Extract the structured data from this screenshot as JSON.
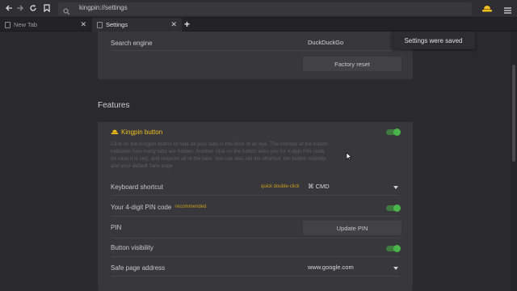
{
  "browser": {
    "url": "kingpin://settings",
    "tabs": [
      {
        "label": "New Tab",
        "active": false
      },
      {
        "label": "Settings",
        "active": true
      }
    ],
    "new_tab_glyph": "+",
    "close_glyph": "✕"
  },
  "general": {
    "search_engine_label": "Search engine",
    "search_engine_value": "DuckDuckGo",
    "factory_reset_label": "Factory reset"
  },
  "toast": {
    "text": "Settings were saved"
  },
  "features": {
    "section_title": "Features",
    "kingpin_button": {
      "title": "Kingpin button",
      "description": "Click on the Kingpin button to hide all your tabs in the blink of an eye. The number at the button indicates how many tabs are hidden. Another click on the button asks you for 4-digit PIN code (in case it is set), and reopens all of the tabs. You can also set the shortcut, the button visibility, and your default Safe page",
      "enabled": true
    },
    "keyboard_shortcut": {
      "label": "Keyboard shortcut",
      "hint": "quick double-click",
      "value": "⌘ CMD"
    },
    "pin_code": {
      "label": "Your 4-digit PIN code",
      "hint": "recommended",
      "enabled": true
    },
    "pin": {
      "label": "PIN",
      "button": "Update PIN"
    },
    "button_visibility": {
      "label": "Button visibility",
      "enabled": true
    },
    "safe_page": {
      "label": "Safe page address",
      "value": "www.google.com"
    }
  },
  "colors": {
    "accent_yellow": "#f0c020",
    "toggle_on": "#4ab64a",
    "background": "#2a2a2e",
    "card": "#38373b"
  },
  "icons": [
    "back-arrow-icon",
    "forward-arrow-icon",
    "reload-icon",
    "bookmark-icon",
    "search-icon",
    "kingpin-hat-icon",
    "menu-icon",
    "page-icon",
    "close-icon",
    "dropdown-caret-icon",
    "mouse-cursor-icon"
  ]
}
